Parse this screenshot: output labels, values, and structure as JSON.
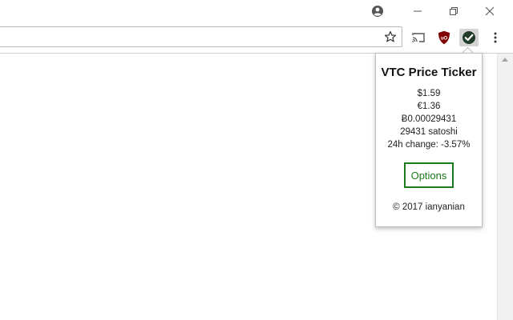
{
  "titlebar": {
    "icons": [
      "account-icon",
      "minimize-icon",
      "restore-icon",
      "close-icon"
    ]
  },
  "toolbar": {
    "omnibox_value": "",
    "icons": [
      "star-icon",
      "cast-icon",
      "ublock-icon",
      "vtc-check-icon",
      "menu-dots-icon"
    ],
    "ublock_label": "uO"
  },
  "popup": {
    "title": "VTC Price Ticker",
    "prices": {
      "usd": "$1.59",
      "eur": "€1.36",
      "btc": "Ƀ0.00029431",
      "satoshi": "29431 satoshi",
      "change": "24h change: -3.57%"
    },
    "options_label": "Options",
    "copyright": "© 2017 ianyanian"
  },
  "colors": {
    "accent_green": "#1b7a1b",
    "ublock_red": "#800000",
    "vtc_badge": "#1f3a26"
  }
}
